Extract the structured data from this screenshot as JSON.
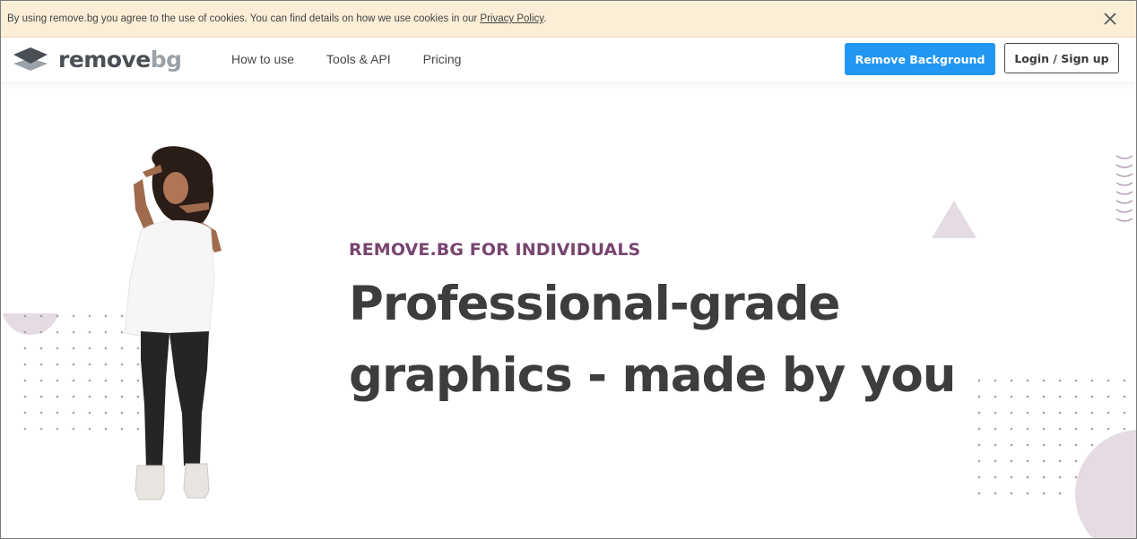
{
  "cookie_banner": {
    "text": "By using remove.bg you agree to the use of cookies. You can find details on how we use cookies in our ",
    "link": "Privacy Policy",
    "end": "."
  },
  "header": {
    "logo": {
      "word1": "remove",
      "word2": "bg"
    },
    "nav": [
      {
        "label": "How to use"
      },
      {
        "label": "Tools & API"
      },
      {
        "label": "Pricing"
      }
    ],
    "primary_button": "Remove Background",
    "login_button": "Login / Sign up"
  },
  "hero": {
    "eyebrow": "REMOVE.BG FOR INDIVIDUALS",
    "headline": "Professional-grade graphics - made by you"
  },
  "colors": {
    "banner_bg": "#fbeed6",
    "primary": "#2196f3",
    "eyebrow": "#784470",
    "headline": "#3d3d3d",
    "deco": "#e4dbe3"
  },
  "icons": {
    "close": "close-icon",
    "logo": "layers-icon"
  }
}
